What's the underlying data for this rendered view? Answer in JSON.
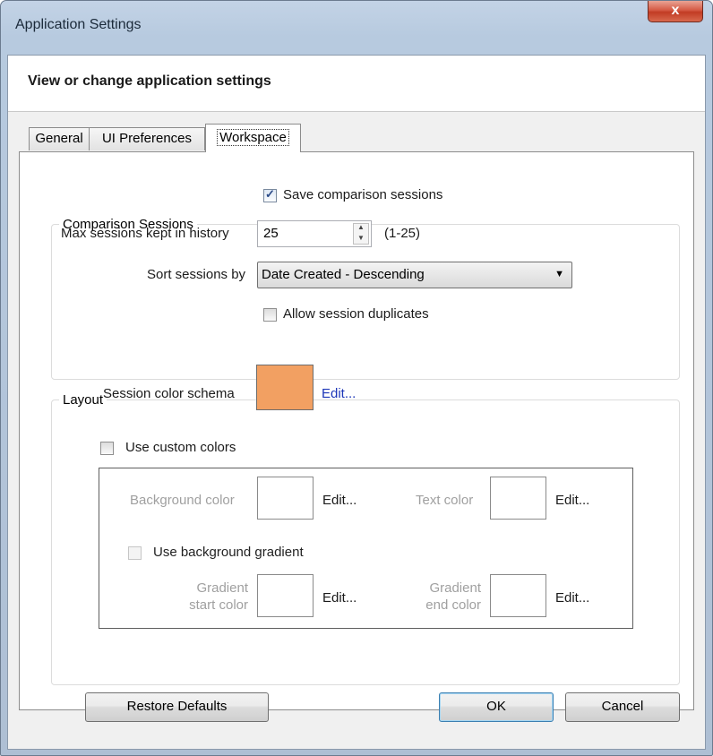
{
  "window": {
    "title": "Application Settings",
    "close_glyph": "x"
  },
  "header": {
    "text": "View or change application settings"
  },
  "tabs": [
    {
      "label": "General",
      "active": false
    },
    {
      "label": "UI Preferences",
      "active": false
    },
    {
      "label": "Workspace",
      "active": true
    }
  ],
  "comparison_sessions": {
    "group_label": "Comparison Sessions",
    "save_sessions": {
      "label": "Save comparison sessions",
      "checked": true
    },
    "max_sessions": {
      "label": "Max sessions kept in history",
      "value": "25",
      "range_hint": "(1-25)"
    },
    "sort_by": {
      "label": "Sort sessions by",
      "selected": "Date Created - Descending"
    },
    "allow_duplicates": {
      "label": "Allow session duplicates",
      "checked": false
    }
  },
  "layout": {
    "group_label": "Layout",
    "session_color": {
      "label": "Session color schema",
      "color": "#f2a062",
      "edit_label": "Edit..."
    },
    "use_custom_colors": {
      "label": "Use custom colors",
      "checked": false
    },
    "background_color": {
      "label": "Background color",
      "edit_label": "Edit..."
    },
    "text_color": {
      "label": "Text color",
      "edit_label": "Edit..."
    },
    "use_gradient": {
      "label": "Use background gradient",
      "checked": false
    },
    "gradient_start": {
      "label_line1": "Gradient",
      "label_line2": "start color",
      "edit_label": "Edit..."
    },
    "gradient_end": {
      "label_line1": "Gradient",
      "label_line2": "end color",
      "edit_label": "Edit..."
    }
  },
  "footer": {
    "restore_defaults": "Restore Defaults",
    "ok": "OK",
    "cancel": "Cancel"
  },
  "icons": {
    "spinner_up": "▲",
    "spinner_down": "▼",
    "dropdown_arrow": "▼"
  }
}
